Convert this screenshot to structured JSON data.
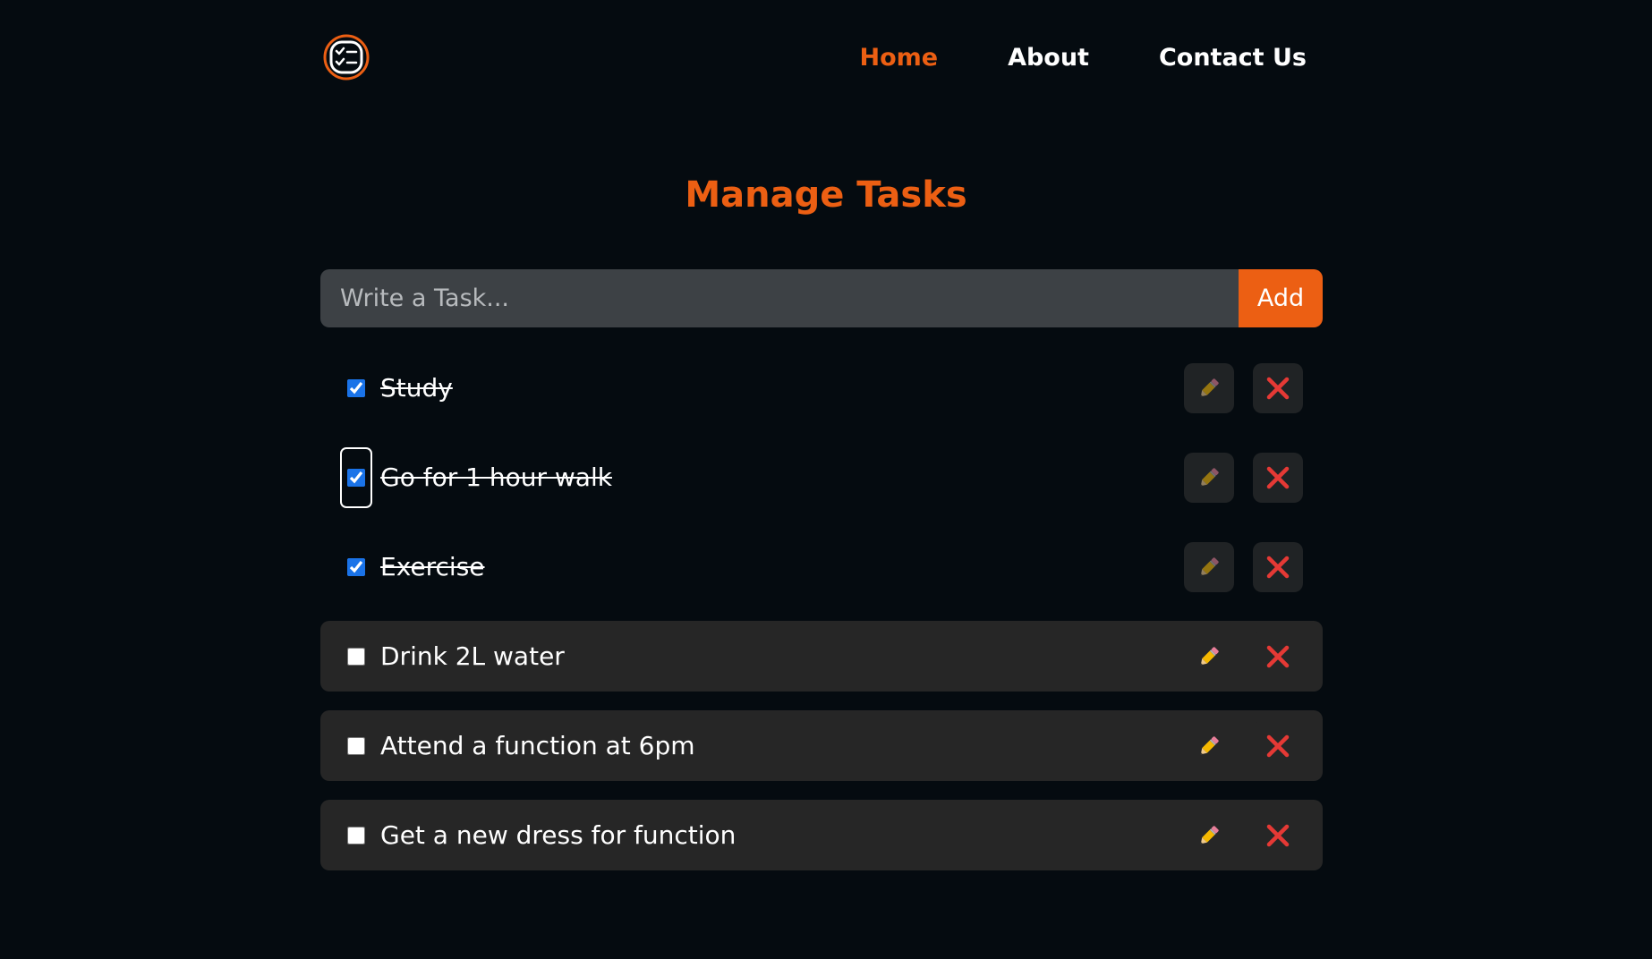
{
  "nav": {
    "logo_icon": "checklist-icon",
    "links": [
      {
        "label": "Home",
        "active": true
      },
      {
        "label": "About",
        "active": false
      },
      {
        "label": "Contact Us",
        "active": false
      }
    ]
  },
  "page_title": "Manage Tasks",
  "form": {
    "placeholder": "Write a Task...",
    "input_value": "",
    "add_label": "Add"
  },
  "tasks": [
    {
      "text": "Study",
      "completed": true
    },
    {
      "text": "Go for 1 hour walk",
      "completed": true,
      "focused": true
    },
    {
      "text": "Exercise",
      "completed": true
    },
    {
      "text": "Drink 2L water",
      "completed": false
    },
    {
      "text": "Attend a function at 6pm",
      "completed": false
    },
    {
      "text": "Get a new dress for function",
      "completed": false
    }
  ],
  "icons": {
    "edit": "pencil-icon",
    "delete": "close-icon"
  },
  "colors": {
    "accent": "#ec5f13",
    "background": "#050b10",
    "checkbox": "#1a73e8",
    "delete": "#e53935",
    "pending_row": "#262626"
  }
}
